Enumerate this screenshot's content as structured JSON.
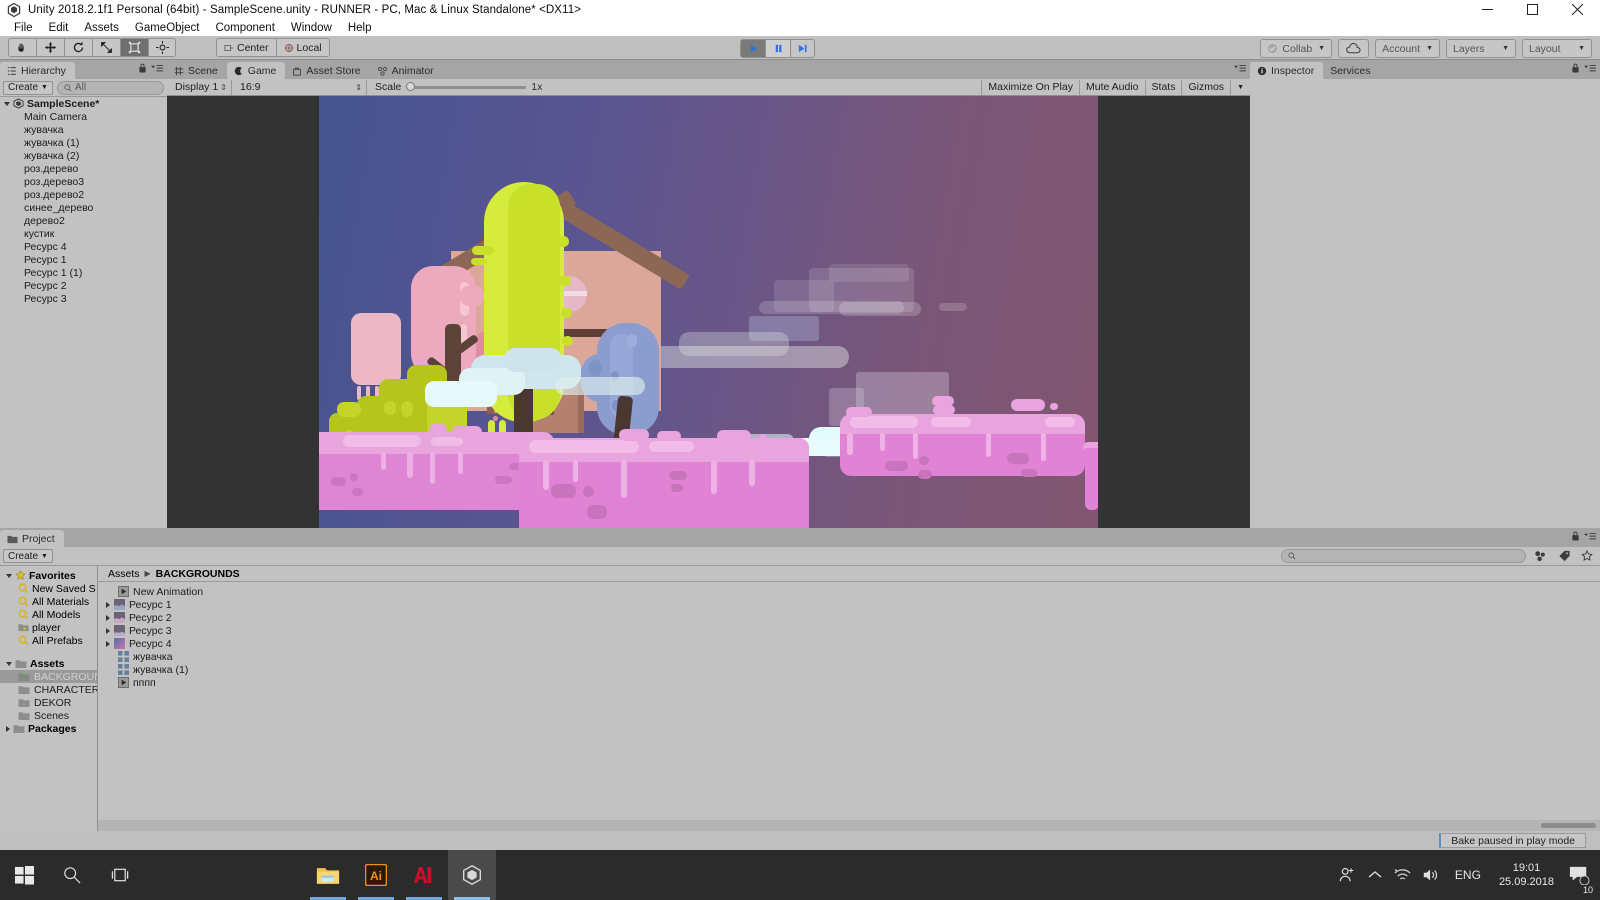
{
  "window": {
    "title": "Unity 2018.2.1f1 Personal (64bit) - SampleScene.unity - RUNNER - PC, Mac & Linux Standalone* <DX11>",
    "minimize_icon": "minimize-icon",
    "maximize_icon": "maximize-icon",
    "close_icon": "close-icon"
  },
  "menubar": {
    "items": [
      "File",
      "Edit",
      "Assets",
      "GameObject",
      "Component",
      "Window",
      "Help"
    ]
  },
  "toolbar": {
    "transform_tools": [
      {
        "name": "hand-tool",
        "active": false
      },
      {
        "name": "move-tool",
        "active": false
      },
      {
        "name": "rotate-tool",
        "active": false
      },
      {
        "name": "scale-tool",
        "active": false
      },
      {
        "name": "rect-tool",
        "active": true
      },
      {
        "name": "transform-tool",
        "active": false
      }
    ],
    "pivot_label": "Center",
    "rotation_label": "Local",
    "play_label": "play",
    "pause_label": "pause",
    "step_label": "step",
    "collab_label": "Collab",
    "cloud_label": "cloud-icon",
    "account_label": "Account",
    "layers_label": "Layers",
    "layout_label": "Layout"
  },
  "hierarchy": {
    "tab_label": "Hierarchy",
    "create_label": "Create",
    "search_placeholder": "All",
    "scene_root": "SampleScene*",
    "items": [
      "Main Camera",
      "жувачка",
      "жувачка (1)",
      "жувачка (2)",
      "роз.дерево",
      "роз.дерево3",
      "роз.дерево2",
      "синее_дерево",
      "дерево2",
      "кустик",
      "Ресурс 4",
      "Ресурс 1",
      "Ресурс 1 (1)",
      "Ресурс 2",
      "Ресурс 3"
    ]
  },
  "gameview": {
    "tabs": [
      {
        "label": "Scene",
        "icon": "scene-grid-icon",
        "active": false
      },
      {
        "label": "Game",
        "icon": "game-moon-icon",
        "active": true
      },
      {
        "label": "Asset Store",
        "icon": "store-icon",
        "active": false
      },
      {
        "label": "Animator",
        "icon": "animator-icon",
        "active": false
      }
    ],
    "display": "Display 1",
    "aspect": "16:9",
    "scale_label": "Scale",
    "scale_value": "1x",
    "maximize_on_play": "Maximize On Play",
    "mute_audio": "Mute Audio",
    "stats": "Stats",
    "gizmos": "Gizmos"
  },
  "inspector": {
    "tabs": [
      {
        "label": "Inspector",
        "active": true
      },
      {
        "label": "Services",
        "active": false
      }
    ]
  },
  "project": {
    "tab_label": "Project",
    "create_label": "Create",
    "search_placeholder": "",
    "breadcrumb": [
      "Assets",
      "BACKGROUNDS"
    ],
    "favorites_label": "Favorites",
    "favorites": [
      {
        "label": "New Saved S",
        "icon": "search-icon"
      },
      {
        "label": "All Materials",
        "icon": "search-icon"
      },
      {
        "label": "All Models",
        "icon": "search-icon"
      },
      {
        "label": "player",
        "icon": "saved-search-icon"
      },
      {
        "label": "All Prefabs",
        "icon": "search-icon"
      }
    ],
    "assets_label": "Assets",
    "folders": [
      {
        "label": "BACKGROUNDS",
        "selected": true
      },
      {
        "label": "CHARACTERS",
        "selected": false
      },
      {
        "label": "DEKOR",
        "selected": false
      },
      {
        "label": "Scenes",
        "selected": false
      }
    ],
    "packages_label": "Packages",
    "assets_items": [
      {
        "label": "New Animation",
        "icon": "animation-icon",
        "expandable": false
      },
      {
        "label": "Ресурс 1",
        "icon": "sprite-icon",
        "expandable": true
      },
      {
        "label": "Ресурс 2",
        "icon": "sprite-icon",
        "expandable": true
      },
      {
        "label": "Ресурс 3",
        "icon": "sprite-icon",
        "expandable": true
      },
      {
        "label": "Ресурс 4",
        "icon": "sprite-icon",
        "expandable": true
      },
      {
        "label": "жувачка",
        "icon": "sprite-sheet-icon",
        "expandable": false
      },
      {
        "label": "жувачка (1)",
        "icon": "sprite-sheet-icon",
        "expandable": false
      },
      {
        "label": "пппп",
        "icon": "animation-icon",
        "expandable": false
      }
    ]
  },
  "statusbar": {
    "message": "Bake paused in play mode"
  },
  "taskbar": {
    "start_icon": "windows-start-icon",
    "search_icon": "search-icon",
    "taskview_icon": "task-view-icon",
    "apps": [
      {
        "name": "file-explorer-icon",
        "active": false
      },
      {
        "name": "illustrator-icon",
        "active": false
      },
      {
        "name": "after-effects-icon",
        "active": false
      },
      {
        "name": "unity-icon",
        "active": true
      }
    ],
    "tray": [
      {
        "name": "people-icon"
      },
      {
        "name": "show-hidden-icons-chevron"
      },
      {
        "name": "wifi-icon"
      },
      {
        "name": "volume-icon"
      }
    ],
    "language": "ENG",
    "time": "19:01",
    "date": "25.09.2018",
    "notification_count": "10"
  },
  "colors": {
    "unity_bg": "#c2c2c2",
    "panel_bg": "#a5a5a5",
    "toolbar_bg": "#bfbfbf",
    "game_letterbox": "#333333",
    "sky_left": "#45548d",
    "sky_right": "#81566f",
    "ground_pink": "#e07fd2",
    "ground_pink_light": "#e79edb",
    "bush_green": "#b5c41a",
    "tree_lime": "#d7ee40",
    "tree_pink": "#f0aec0",
    "tree_blue": "#8c9fd0",
    "house_wall": "#d9a898",
    "house_wood": "#6e4f44",
    "cloud_white": "#dff7f7",
    "accent_blue": "#3a76d8",
    "taskbar_bg": "#2b2b2b"
  }
}
